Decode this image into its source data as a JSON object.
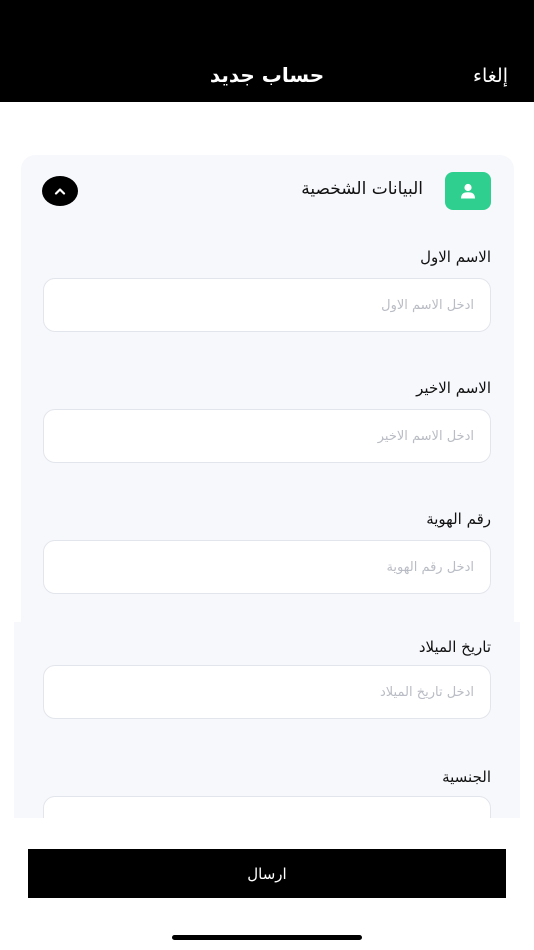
{
  "header": {
    "title": "حساب جديد",
    "cancel_label": "إلغاء"
  },
  "section": {
    "title": "البيانات الشخصية",
    "icon": "person-icon",
    "accent_color": "#2fd08f"
  },
  "fields": [
    {
      "label": "الاسم الاول",
      "placeholder": "ادخل الاسم الاول",
      "value": ""
    },
    {
      "label": "الاسم الاخير",
      "placeholder": "ادخل الاسم الاخير",
      "value": ""
    },
    {
      "label": "رقم الهوية",
      "placeholder": "ادخل رقم الهوية",
      "value": ""
    },
    {
      "label": "تاريخ الميلاد",
      "placeholder": "ادخل تاريخ الميلاد",
      "value": ""
    },
    {
      "label": "الجنسية",
      "placeholder": "",
      "value": ""
    }
  ],
  "footer": {
    "submit_label": "ارسال"
  }
}
